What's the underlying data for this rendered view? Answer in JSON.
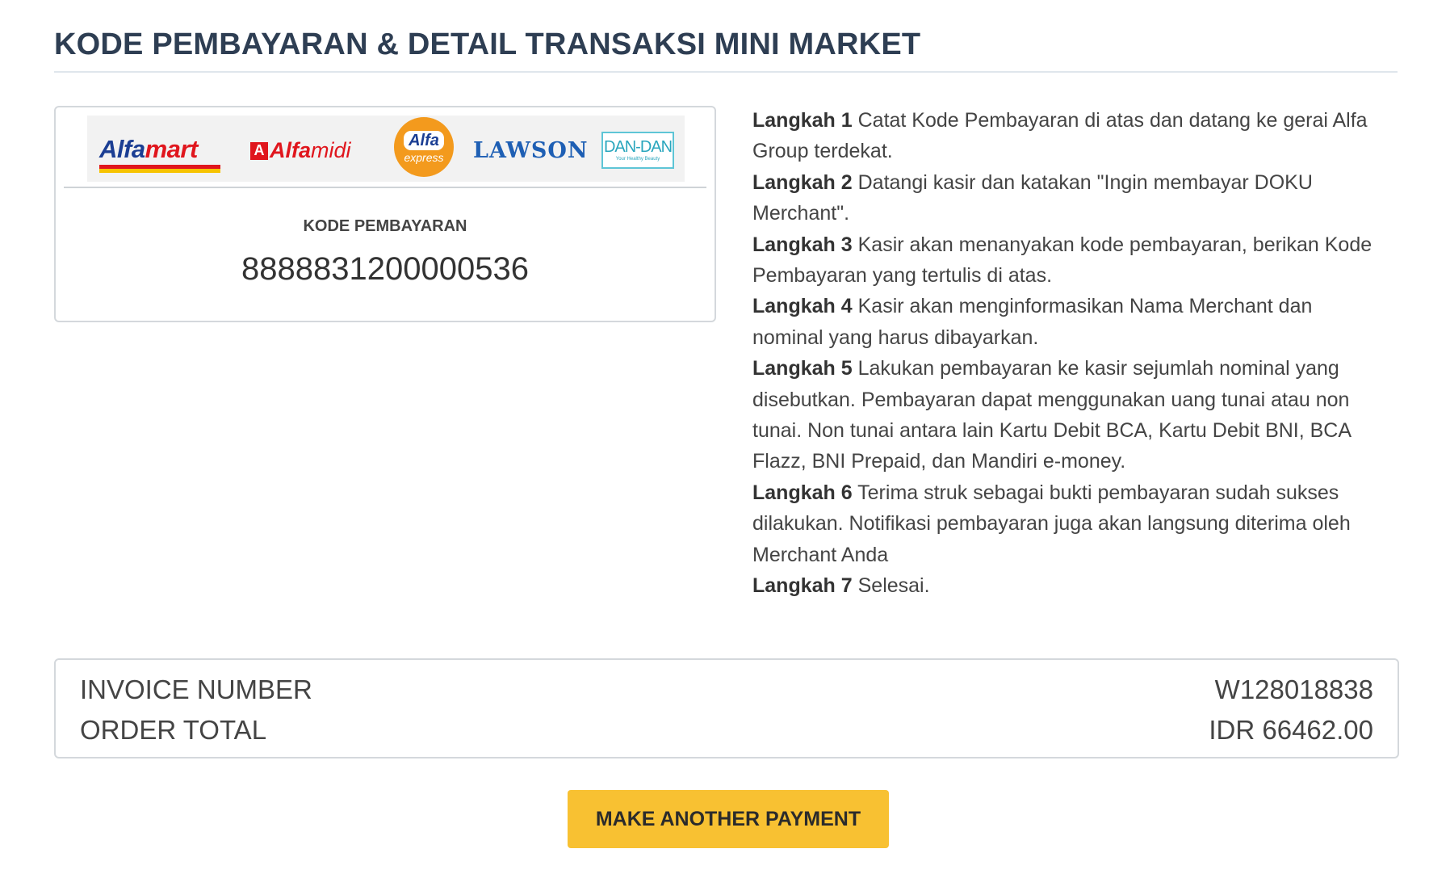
{
  "header": {
    "title": "KODE PEMBAYARAN & DETAIL TRANSAKSI MINI MARKET"
  },
  "payment_card": {
    "logos": {
      "alfamart_part1": "Alfa",
      "alfamart_part2": "mart",
      "alfamidi_mark": "A",
      "alfamidi_part1": "Alfa",
      "alfamidi_part2": "midi",
      "alfa_express_top": "Alfa",
      "alfa_express_bottom": "express",
      "lawson": "LAWSON",
      "dandan": "DAN-DAN",
      "dandan_tagline": "Your Healthy Beauty"
    },
    "code_label": "KODE PEMBAYARAN",
    "code_value": "8888831200000536"
  },
  "steps": [
    {
      "label": "Langkah 1",
      "text": "Catat Kode Pembayaran di atas dan datang ke gerai Alfa Group terdekat."
    },
    {
      "label": "Langkah 2",
      "text": "Datangi kasir dan katakan \"Ingin membayar DOKU Merchant\"."
    },
    {
      "label": "Langkah 3",
      "text": "Kasir akan menanyakan kode pembayaran, berikan Kode Pembayaran yang tertulis di atas."
    },
    {
      "label": "Langkah 4",
      "text": "Kasir akan menginformasikan Nama Merchant dan nominal yang harus dibayarkan."
    },
    {
      "label": "Langkah 5",
      "text": "Lakukan pembayaran ke kasir sejumlah nominal yang disebutkan. Pembayaran dapat menggunakan uang tunai atau non tunai. Non tunai antara lain Kartu Debit BCA, Kartu Debit BNI, BCA Flazz, BNI Prepaid, dan Mandiri e-money."
    },
    {
      "label": "Langkah 6",
      "text": "Terima struk sebagai bukti pembayaran sudah sukses dilakukan. Notifikasi pembayaran juga akan langsung diterima oleh Merchant Anda"
    },
    {
      "label": "Langkah 7",
      "text": "Selesai."
    }
  ],
  "summary": {
    "invoice_label": "INVOICE NUMBER",
    "invoice_value": "W128018838",
    "total_label": "ORDER TOTAL",
    "total_value": "IDR 66462.00"
  },
  "actions": {
    "another_payment_label": "MAKE ANOTHER PAYMENT"
  },
  "colors": {
    "title": "#2e3e53",
    "button": "#f8c132",
    "alfa_red": "#e0161d",
    "alfa_blue": "#1b3e93",
    "express_orange": "#f39a1d",
    "lawson_blue": "#1e5fb4",
    "dandan_teal": "#2aa6bd"
  }
}
